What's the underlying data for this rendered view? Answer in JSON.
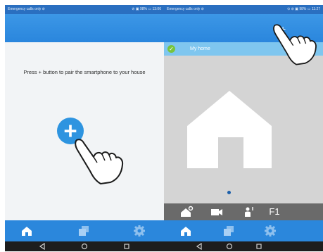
{
  "screens": [
    {
      "status_bar": {
        "carrier": "Emergency calls only ⊘",
        "indicators": "⊘ ▣ 98% ▭ 13:06"
      },
      "instruction": "Press + button to pair the smartphone to your house",
      "pair_button": {
        "label": "+"
      },
      "tabs": [
        {
          "icon": "home-icon"
        },
        {
          "icon": "rooms-icon"
        },
        {
          "icon": "gear-icon"
        }
      ],
      "nav": [
        {
          "icon": "back-icon"
        },
        {
          "icon": "home-circle-icon"
        },
        {
          "icon": "recents-icon"
        }
      ]
    },
    {
      "status_bar": {
        "carrier": "Emergency calls only ⊘",
        "indicators": "⊙ ⊘ ▣ 98% ▭ 11:27"
      },
      "header_action": "+",
      "home": {
        "name": "My home",
        "selected": true
      },
      "controls": [
        {
          "icon": "house-gear-icon"
        },
        {
          "icon": "camera-icon"
        },
        {
          "icon": "intercom-icon"
        },
        {
          "label": "F1"
        }
      ],
      "tabs": [
        {
          "icon": "home-icon"
        },
        {
          "icon": "rooms-icon"
        },
        {
          "icon": "gear-icon"
        }
      ],
      "nav": [
        {
          "icon": "back-icon"
        },
        {
          "icon": "home-circle-icon"
        },
        {
          "icon": "recents-icon"
        }
      ]
    }
  ],
  "colors": {
    "appbar": "#2a86dd",
    "statusbar": "#2a6fc0",
    "home_row": "#7fc6ef",
    "check": "#77c43d",
    "control_bar": "#6a6a6a",
    "nav_bar": "#1d1d1d"
  }
}
